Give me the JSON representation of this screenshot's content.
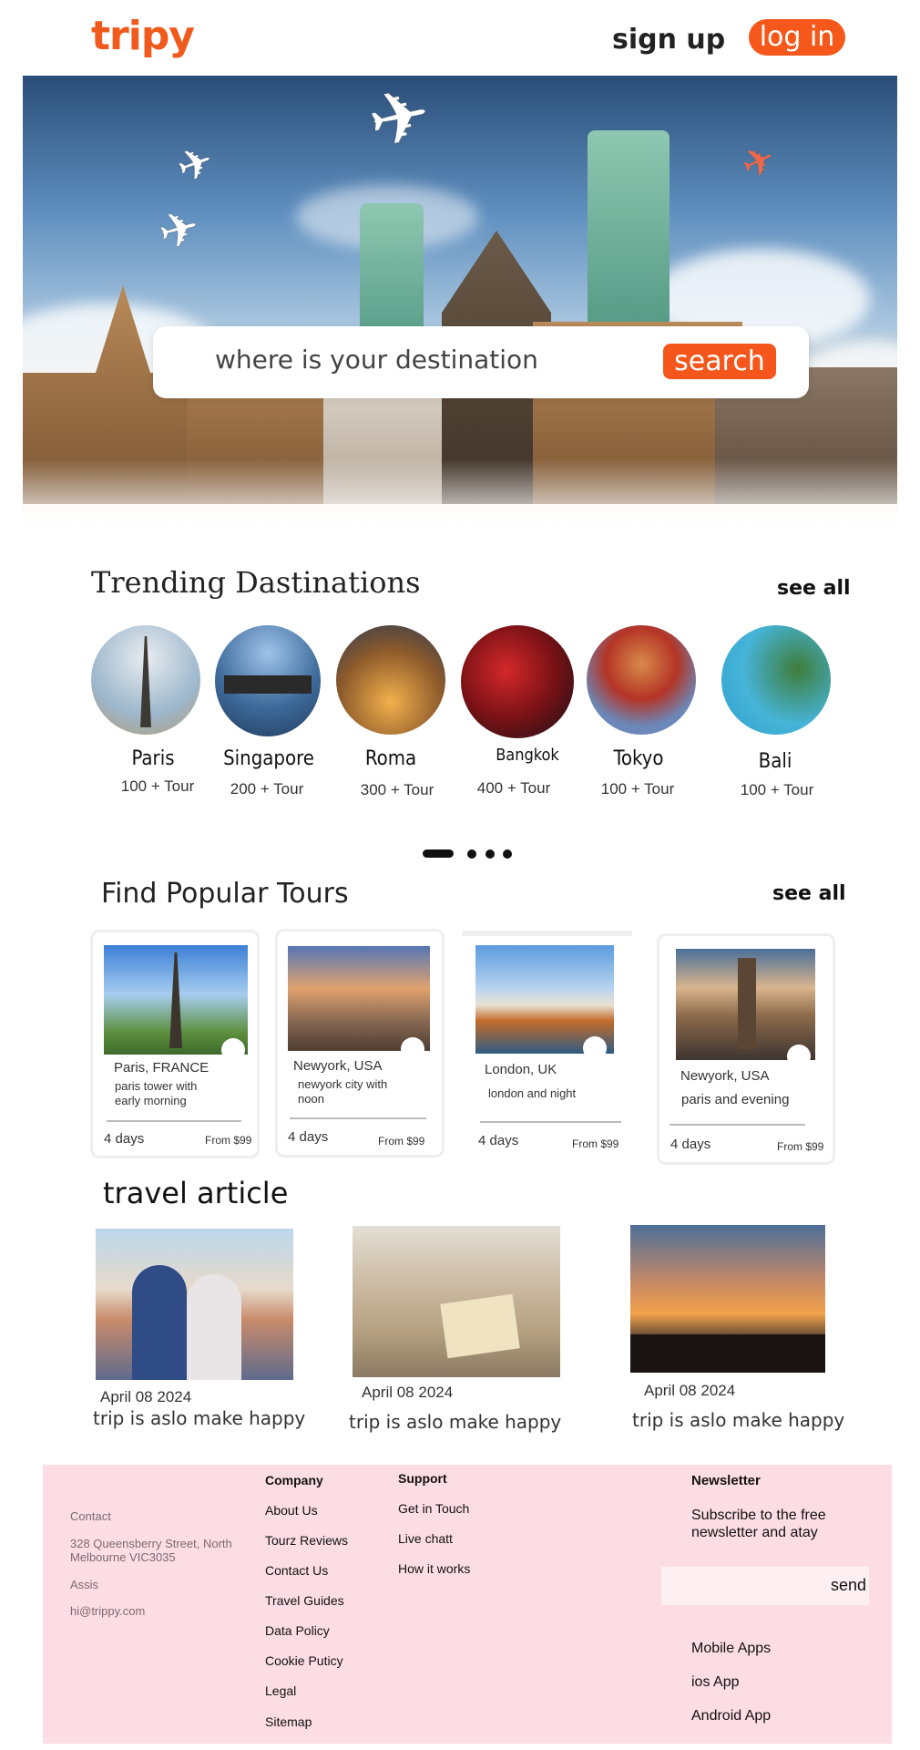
{
  "header": {
    "logo": "tripy",
    "signup_label": "sign up",
    "login_label": "log in"
  },
  "hero": {
    "search_placeholder": "where is your destination",
    "search_button": "search"
  },
  "trending": {
    "title": "Trending Dastinations",
    "see_all": "see all",
    "items": [
      {
        "name": "Paris",
        "count": "100 + Tour"
      },
      {
        "name": "Singapore",
        "count": "200 + Tour"
      },
      {
        "name": "Roma",
        "count": "300 + Tour"
      },
      {
        "name": "Bangkok",
        "count": "400 + Tour"
      },
      {
        "name": "Tokyo",
        "count": "100 + Tour"
      },
      {
        "name": "Bali",
        "count": "100 + Tour"
      }
    ]
  },
  "tours": {
    "title": "Find Popular Tours",
    "see_all": "see all",
    "items": [
      {
        "location": "Paris, FRANCE",
        "desc": "paris tower with early morning",
        "days": "4 days",
        "price": "From $99"
      },
      {
        "location": "Newyork, USA",
        "desc": "newyork city with noon",
        "days": "4 days",
        "price": "From $99"
      },
      {
        "location": "London, UK",
        "desc": "london and night",
        "days": "4 days",
        "price": "From $99"
      },
      {
        "location": "Newyork, USA",
        "desc": "paris and evening",
        "days": "4 days",
        "price": "From $99"
      }
    ]
  },
  "articles": {
    "title": "travel article",
    "items": [
      {
        "date": "April 08 2024",
        "title": "trip is aslo make happy"
      },
      {
        "date": "April 08 2024",
        "title": "trip is aslo make happy"
      },
      {
        "date": "April 08 2024",
        "title": "trip is aslo make happy"
      }
    ]
  },
  "footer": {
    "contact_label": "Contact",
    "address": "328 Queensberry Street, North Melbourne VIC3035",
    "assis_label": "Assis",
    "email": "hi@trippy.com",
    "company": {
      "heading": "Company",
      "links": [
        "About Us",
        "Tourz Reviews",
        "Contact Us",
        "Travel Guides",
        "Data Policy",
        "Cookie Puticy",
        "Legal",
        "Sitemap"
      ]
    },
    "support": {
      "heading": "Support",
      "links": [
        "Get in Touch",
        "Live chatt",
        "How it works"
      ]
    },
    "newsletter": {
      "heading": "Newsletter",
      "text": "Subscribe to the free newsletter and atay",
      "send_label": "send",
      "apps": [
        "Mobile Apps",
        "ios App",
        "Android App"
      ]
    }
  },
  "colors": {
    "accent": "#f5581a",
    "footer_bg": "#fddde4"
  }
}
